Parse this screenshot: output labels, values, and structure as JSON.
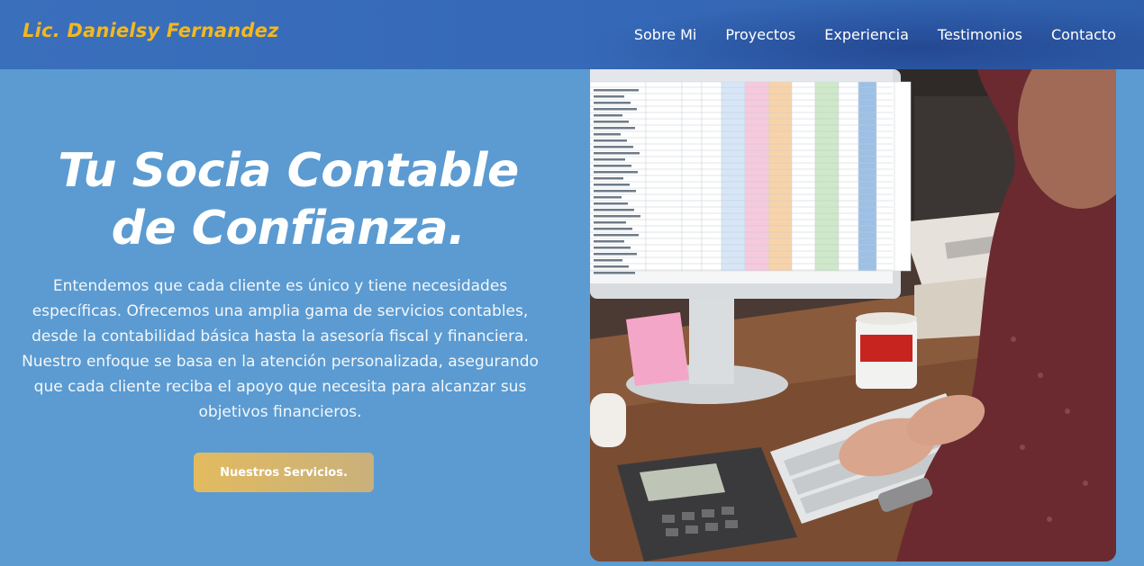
{
  "header": {
    "brand": "Lic. Danielsy Fernandez",
    "nav": [
      "Sobre Mi",
      "Proyectos",
      "Experiencia",
      "Testimonios",
      "Contacto"
    ]
  },
  "hero": {
    "title_line1": "Tu Socia Contable",
    "title_line2": "de Confianza.",
    "description": "Entendemos que cada cliente es único y tiene necesidades específicas. Ofrecemos una amplia gama de servicios contables, desde la contabilidad básica hasta la asesoría fiscal y financiera. Nuestro enfoque se basa en la atención personalizada, asegurando que cada cliente reciba el apoyo que necesita para alcanzar sus objetivos financieros.",
    "cta_label": "Nuestros Servicios."
  },
  "colors": {
    "background": "#5b9bd1",
    "header": "#3569b8",
    "brand": "#f2b81f",
    "cta": "#d9b86a"
  }
}
